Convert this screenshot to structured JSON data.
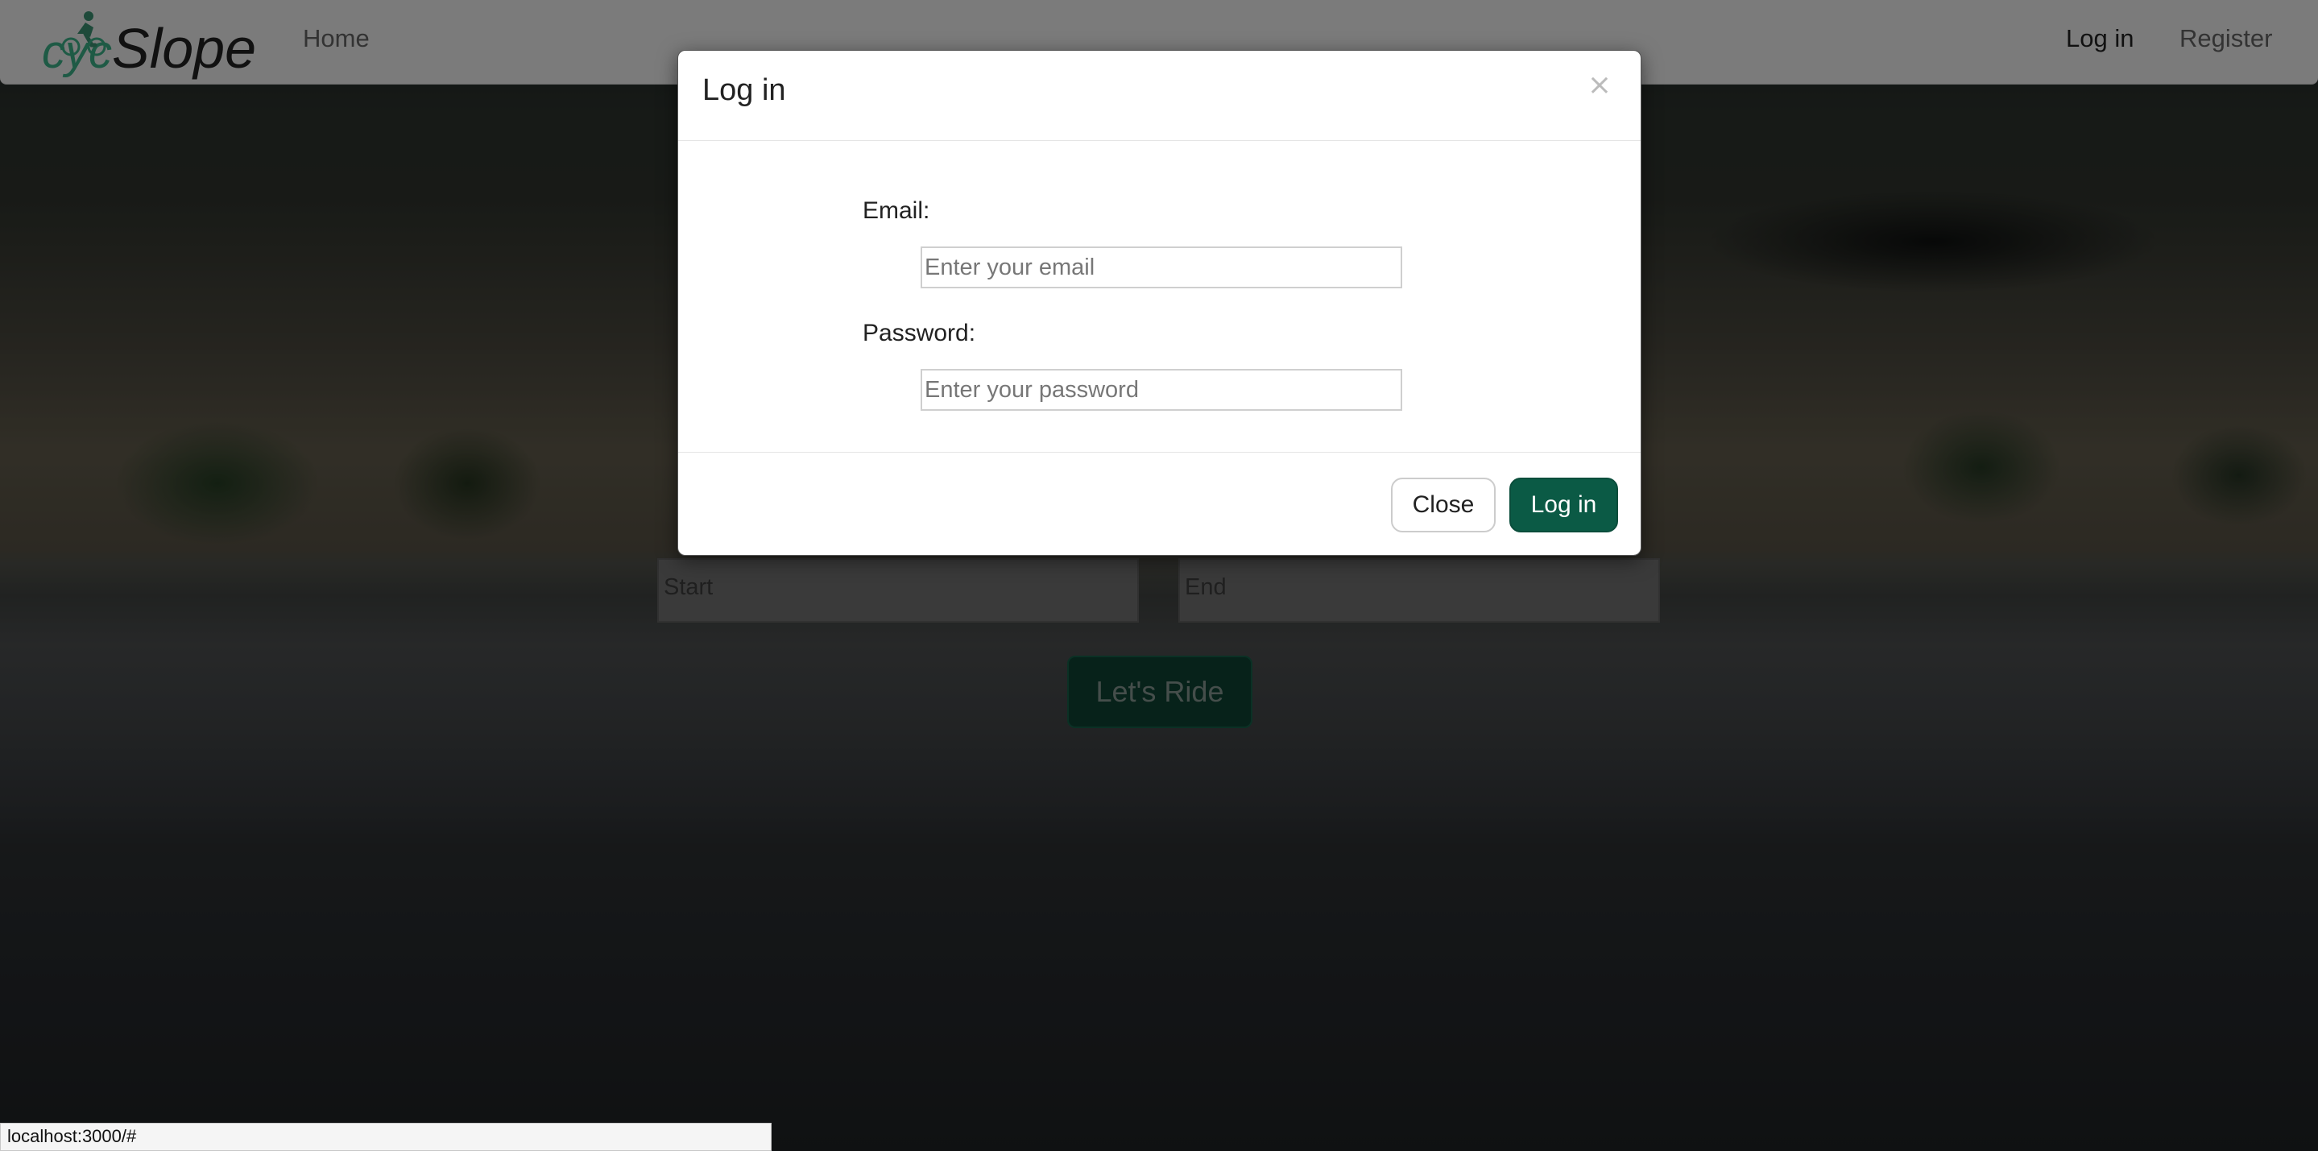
{
  "navbar": {
    "brand_prefix": "cyc",
    "brand_suffix": "Slope",
    "home_label": "Home",
    "login_label": "Log in",
    "register_label": "Register"
  },
  "background_form": {
    "start_placeholder": "Start",
    "end_placeholder": "End",
    "ride_button_label": "Let's Ride"
  },
  "modal": {
    "title": "Log in",
    "close_symbol": "×",
    "email_label": "Email:",
    "email_placeholder": "Enter your email",
    "email_value": "",
    "password_label": "Password:",
    "password_placeholder": "Enter your password",
    "password_value": "",
    "close_button_label": "Close",
    "login_button_label": "Log in"
  },
  "status_bar": {
    "url": "localhost:3000/#"
  },
  "colors": {
    "accent_green": "#0b5a45",
    "brand_green": "#1e5a45",
    "navbar_bg": "#7b7b7b"
  },
  "icons": {
    "brand_icon": "cyclist-icon",
    "modal_close_icon": "close-icon"
  }
}
